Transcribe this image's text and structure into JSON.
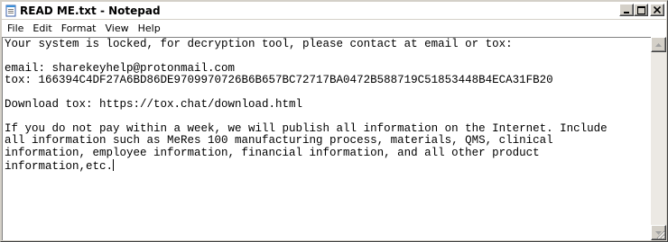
{
  "window": {
    "title": "READ ME.txt - Notepad",
    "icon": "notepad-icon",
    "controls": [
      "minimize-icon",
      "maximize-icon",
      "close-icon"
    ]
  },
  "menubar": {
    "items": [
      "File",
      "Edit",
      "Format",
      "View",
      "Help"
    ]
  },
  "document": {
    "text": "Your system is locked, for decryption tool, please contact at email or tox:\n\nemail: sharekeyhelp@protonmail.com\ntox: 166394C4DF27A6BD86DE9709970726B6B657BC72717BA0472B588719C51853448B4ECA31FB20\n\nDownload tox: https://tox.chat/download.html\n\nIf you do not pay within a week, we will publish all information on the Internet. Include\nall information such as MeRes 100 manufacturing process, materials, QMS, clinical\ninformation, employee information, financial information, and all other product\ninformation,etc."
  },
  "colors": {
    "titlebar": "#ffffff",
    "chrome": "#d4d0c8",
    "editor_background": "#ffffff",
    "text": "#000000"
  }
}
